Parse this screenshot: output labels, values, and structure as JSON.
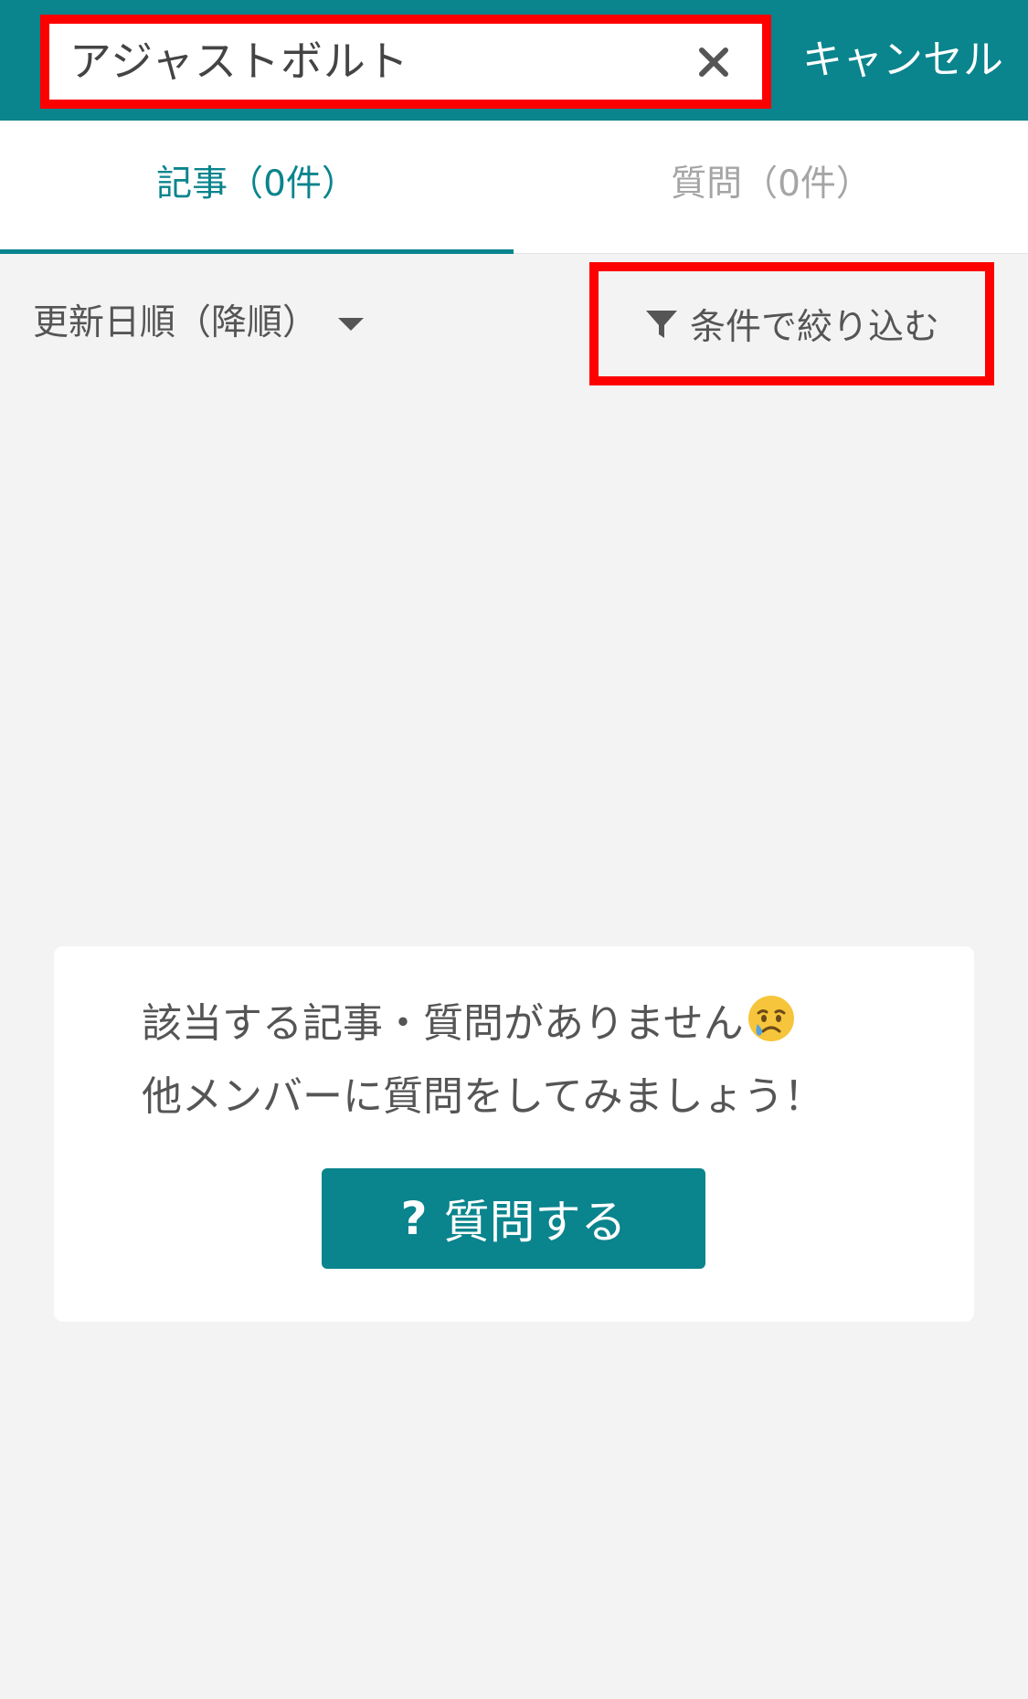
{
  "search": {
    "query": "アジャストボルト",
    "cancel_label": "キャンセル"
  },
  "tabs": [
    {
      "label": "記事（0件）",
      "active": true
    },
    {
      "label": "質問（0件）",
      "active": false
    }
  ],
  "toolbar": {
    "sort_label": "更新日順（降順）",
    "filter_label": "条件で絞り込む"
  },
  "empty_state": {
    "message_line1": "該当する記事・質問がありません",
    "message_line2": "他メンバーに質問をしてみましょう！",
    "ask_button_icon": "?",
    "ask_button_label": "質問する"
  },
  "colors": {
    "brand": "#0a848d",
    "highlight": "#ff0000",
    "background": "#f3f3f3"
  },
  "icons": [
    "close-icon",
    "chevron-down-icon",
    "filter-icon",
    "crying-face-icon",
    "question-icon"
  ]
}
